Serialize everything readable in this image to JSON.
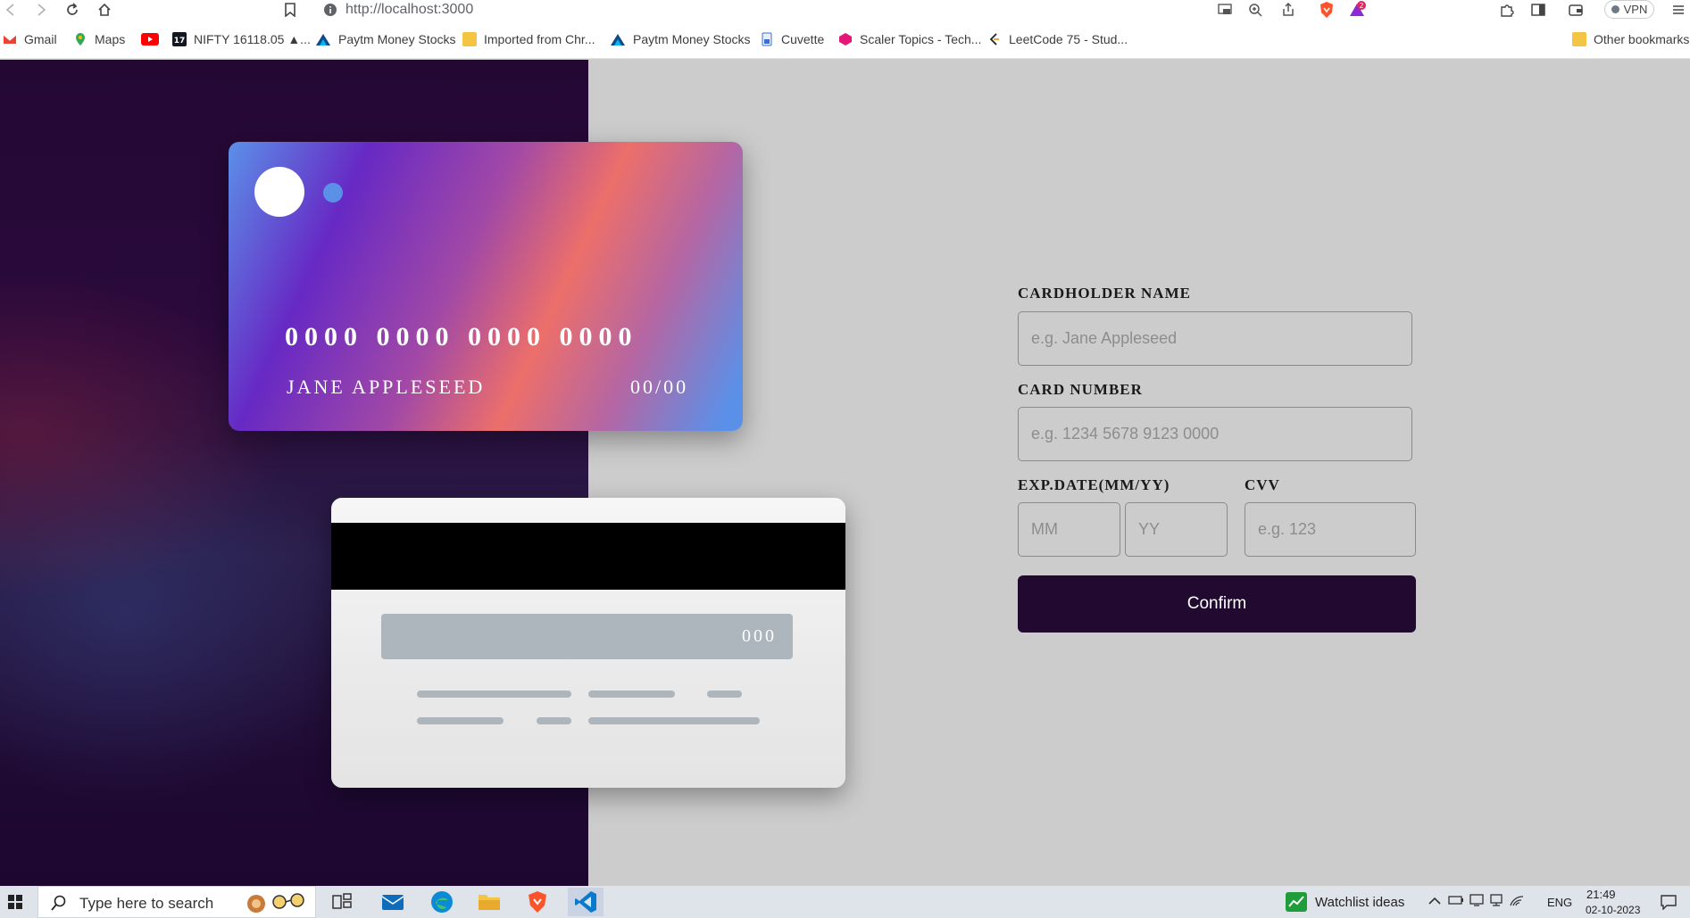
{
  "browser": {
    "url": "http://localhost:3000",
    "vpn_label": "VPN",
    "brave_badge": "2"
  },
  "bookmarks": [
    {
      "label": "Gmail"
    },
    {
      "label": "Maps"
    },
    {
      "label": ""
    },
    {
      "label": "NIFTY 16118.05 ▲..."
    },
    {
      "label": "Paytm Money Stocks"
    },
    {
      "label": "Imported from Chr..."
    },
    {
      "label": "Paytm Money Stocks"
    },
    {
      "label": "Cuvette"
    },
    {
      "label": "Scaler Topics - Tech..."
    },
    {
      "label": "LeetCode 75 - Stud..."
    }
  ],
  "other_bookmarks": "Other bookmarks",
  "card_front": {
    "number": "0000 0000 0000 0000",
    "name": "JANE APPLESEED",
    "expiry": "00/00"
  },
  "card_back": {
    "cvv": "000"
  },
  "form": {
    "name_label": "CARDHOLDER NAME",
    "name_placeholder": "e.g. Jane Appleseed",
    "number_label": "CARD NUMBER",
    "number_placeholder": "e.g. 1234 5678 9123 0000",
    "exp_label": "EXP.DATE(MM/YY)",
    "mm_placeholder": "MM",
    "yy_placeholder": "YY",
    "cvv_label": "CVV",
    "cvv_placeholder": "e.g. 123",
    "confirm_label": "Confirm"
  },
  "taskbar": {
    "search_placeholder": "Type here to search",
    "watchlist_label": "Watchlist ideas",
    "lang": "ENG",
    "time": "21:49",
    "date": "02-10-2023"
  },
  "colors": {
    "left_bg": "#240834",
    "page_bg": "#cccccc",
    "confirm_bg": "#210930",
    "card_blue": "#5b90e8",
    "card_purple": "#6729c4",
    "card_coral": "#ec6f6a",
    "cvv_strip": "#adb5bd"
  }
}
